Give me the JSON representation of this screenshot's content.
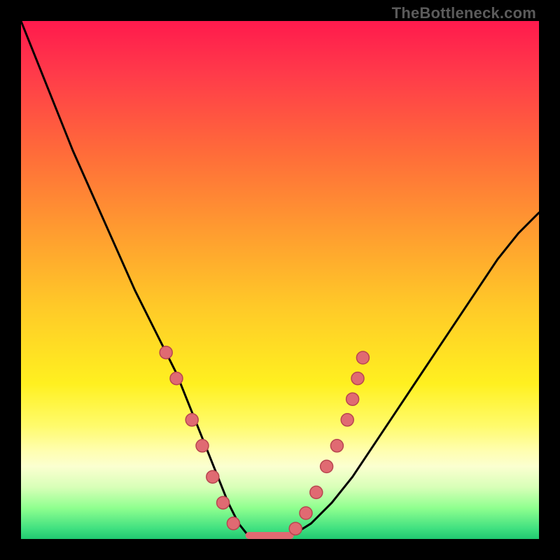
{
  "watermark": "TheBottleneck.com",
  "colors": {
    "curve": "#000000",
    "marker_fill": "#e06a72",
    "marker_stroke": "#b8464f",
    "gradient_top": "#ff1a4d",
    "gradient_bottom": "#20c870"
  },
  "chart_data": {
    "type": "line",
    "title": "",
    "xlabel": "",
    "ylabel": "",
    "xlim": [
      0,
      100
    ],
    "ylim": [
      0,
      100
    ],
    "grid": false,
    "legend": false,
    "x": [
      0,
      2,
      6,
      10,
      14,
      18,
      22,
      26,
      28,
      30,
      32,
      34,
      36,
      38,
      40,
      42,
      44,
      46,
      48,
      50,
      52,
      56,
      60,
      64,
      68,
      72,
      76,
      80,
      84,
      88,
      92,
      96,
      100
    ],
    "y": [
      100,
      95,
      85,
      75,
      66,
      57,
      48,
      40,
      36,
      32,
      27,
      22,
      17,
      12,
      7,
      3,
      0.5,
      0,
      0,
      0,
      0.5,
      3,
      7,
      12,
      18,
      24,
      30,
      36,
      42,
      48,
      54,
      59,
      63
    ],
    "bottom_plateau": {
      "x_start": 44,
      "x_end": 52,
      "y": 0
    },
    "markers_left": [
      {
        "x": 28,
        "y": 36
      },
      {
        "x": 30,
        "y": 31
      },
      {
        "x": 33,
        "y": 23
      },
      {
        "x": 35,
        "y": 18
      },
      {
        "x": 37,
        "y": 12
      },
      {
        "x": 39,
        "y": 7
      },
      {
        "x": 41,
        "y": 3
      }
    ],
    "markers_right": [
      {
        "x": 53,
        "y": 2
      },
      {
        "x": 55,
        "y": 5
      },
      {
        "x": 57,
        "y": 9
      },
      {
        "x": 59,
        "y": 14
      },
      {
        "x": 61,
        "y": 18
      },
      {
        "x": 63,
        "y": 23
      },
      {
        "x": 64,
        "y": 27
      },
      {
        "x": 65,
        "y": 31
      },
      {
        "x": 66,
        "y": 35
      }
    ]
  }
}
